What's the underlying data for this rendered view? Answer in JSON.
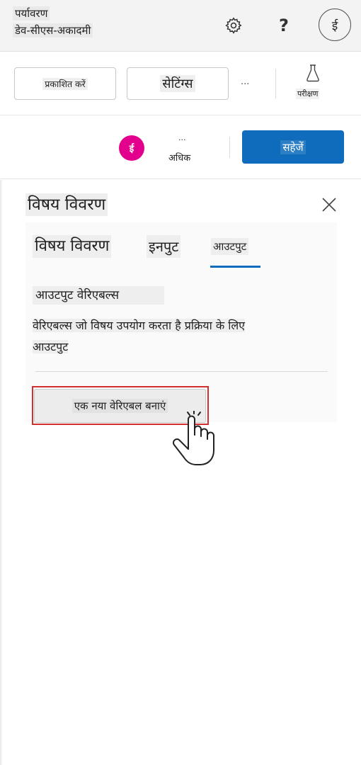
{
  "header": {
    "env_label": "पर्यावरण",
    "env_name": "डेव-सीएस-अकादमी",
    "help_symbol": "?",
    "avatar_initial": "ई",
    "settings_icon": "gear-icon"
  },
  "commandbar": {
    "publish_label": "प्रकाशित करें",
    "settings_label": "सेटिंग्स",
    "more_symbol": "...",
    "test_label": "परीक्षण",
    "test_icon": "flask-icon"
  },
  "row2": {
    "user_initial": "ई",
    "more_symbol": "...",
    "more_label": "अधिक",
    "save_label": "सहेजें"
  },
  "panel": {
    "title": "विषय विवरण",
    "tabs": [
      {
        "label": "विषय विवरण"
      },
      {
        "label": "इनपुट"
      },
      {
        "label": "आउटपुट"
      }
    ],
    "active_tab": "आउटपुट",
    "section_title": "आउटपुट वेरिएबल्स",
    "section_description_line1": "वेरिएबल्स जो विषय उपयोग करता है प्रक्रिया के लिए",
    "section_description_line2": "आउटपुट",
    "create_button_label": "एक नया वेरिएबल बनाएं"
  },
  "colors": {
    "accent": "#0f6cbd",
    "avatar_pink": "#e3008c",
    "highlight_red": "#d32f2f"
  }
}
